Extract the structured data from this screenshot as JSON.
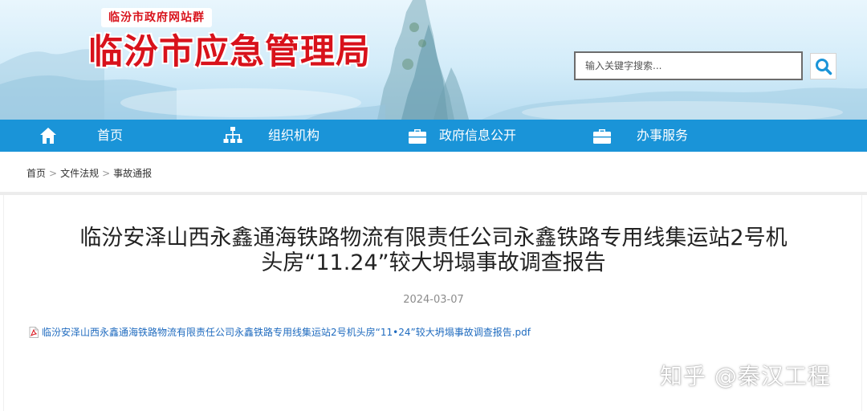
{
  "header": {
    "site_group": "临汾市政府网站群",
    "site_title": "临汾市应急管理局",
    "search_placeholder": "输入关键字搜索..."
  },
  "nav": {
    "items": [
      {
        "label": "首页",
        "icon": "home-icon"
      },
      {
        "label": "组织机构",
        "icon": "org-chart-icon"
      },
      {
        "label": "政府信息公开",
        "icon": "briefcase-icon"
      },
      {
        "label": "办事服务",
        "icon": "briefcase-icon"
      }
    ]
  },
  "breadcrumb": {
    "items": [
      "首页",
      "文件法规",
      "事故通报"
    ],
    "separator": ">"
  },
  "article": {
    "title_line1": "临汾安泽山西永鑫通海铁路物流有限责任公司永鑫铁路专用线集运站2号机",
    "title_line2": "头房“11.24”较大坍塌事故调查报告",
    "date": "2024-03-07",
    "attachment": "临汾安泽山西永鑫通海铁路物流有限责任公司永鑫铁路专用线集运站2号机头房“11•24”较大坍塌事故调查报告.pdf"
  },
  "watermark": "知乎 @秦汉工程",
  "colors": {
    "brand_red": "#d8121b",
    "nav_blue": "#1a94d8",
    "link_blue": "#1f6bbf"
  }
}
